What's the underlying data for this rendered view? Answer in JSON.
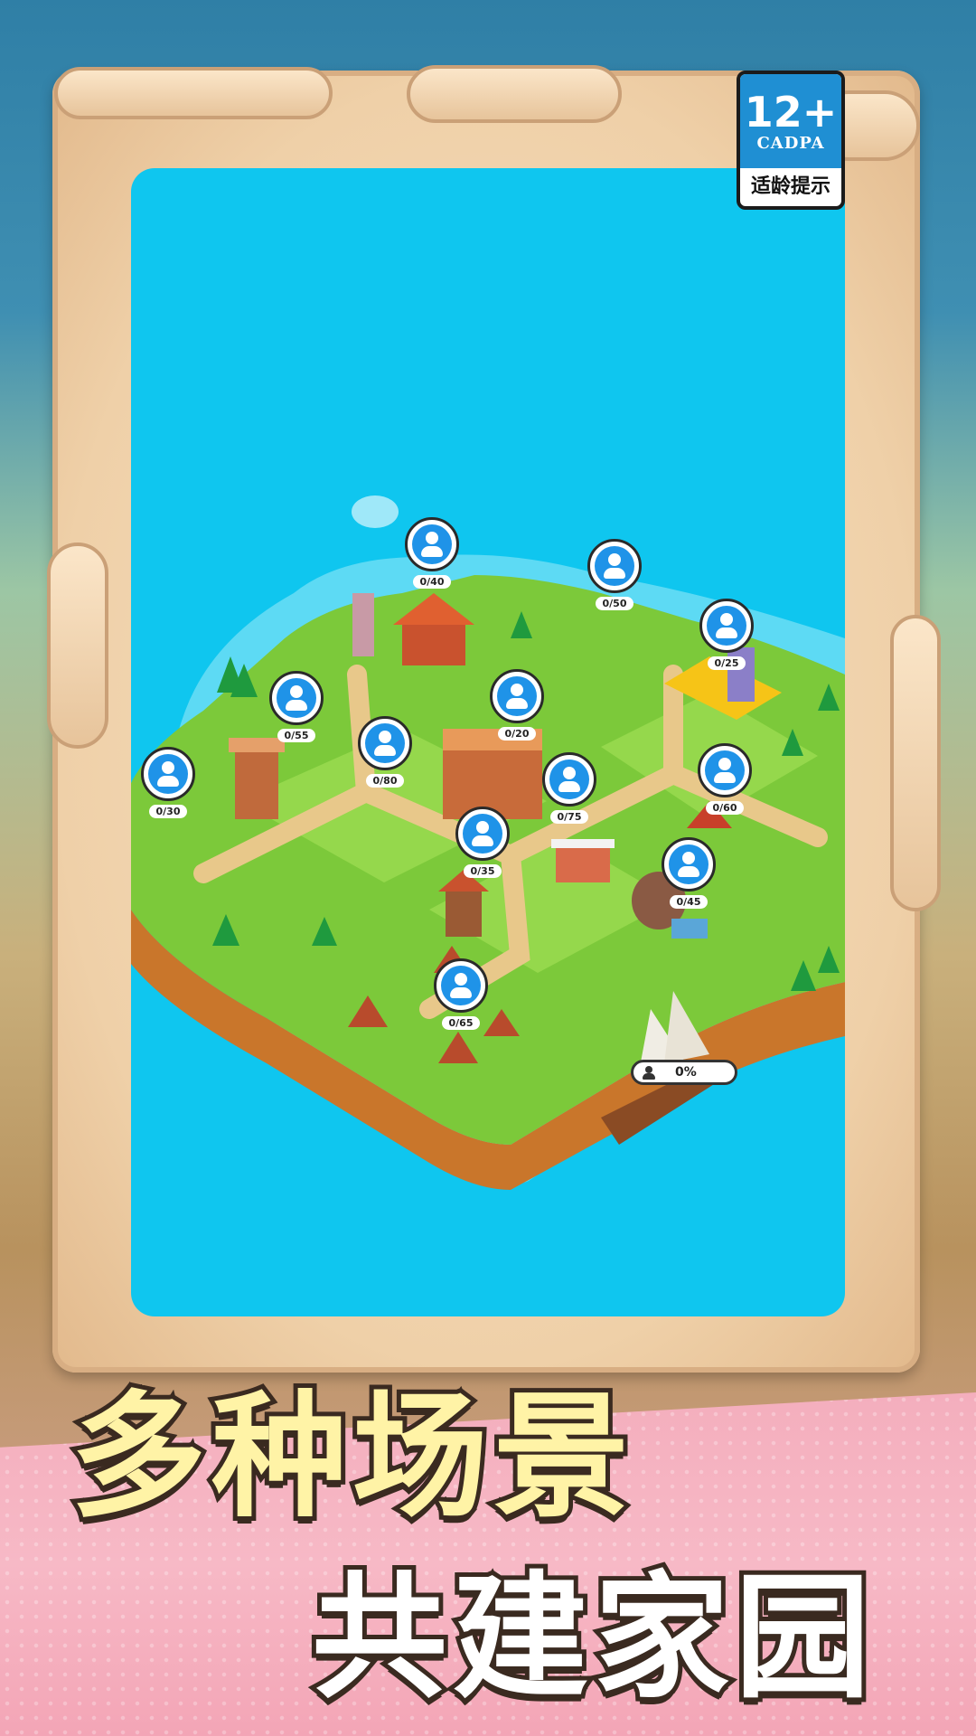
{
  "age_badge": {
    "rating": "12+",
    "org": "CADPA",
    "note": "适龄提示"
  },
  "markers": [
    {
      "id": "m40",
      "count": "0/40"
    },
    {
      "id": "m50",
      "count": "0/50"
    },
    {
      "id": "m25",
      "count": "0/25"
    },
    {
      "id": "m55",
      "count": "0/55"
    },
    {
      "id": "m20",
      "count": "0/20"
    },
    {
      "id": "m80",
      "count": "0/80"
    },
    {
      "id": "m30",
      "count": "0/30"
    },
    {
      "id": "m75",
      "count": "0/75"
    },
    {
      "id": "m60",
      "count": "0/60"
    },
    {
      "id": "m35",
      "count": "0/35"
    },
    {
      "id": "m45",
      "count": "0/45"
    },
    {
      "id": "m65",
      "count": "0/65"
    }
  ],
  "ship": {
    "progress": "0%"
  },
  "headline": {
    "line1": "多种场景",
    "line2": "共建家园"
  },
  "colors": {
    "sea": "#0fc6ef",
    "grass": "#7cc93a",
    "cliff": "#c9762b",
    "marker": "#1f93e8"
  }
}
